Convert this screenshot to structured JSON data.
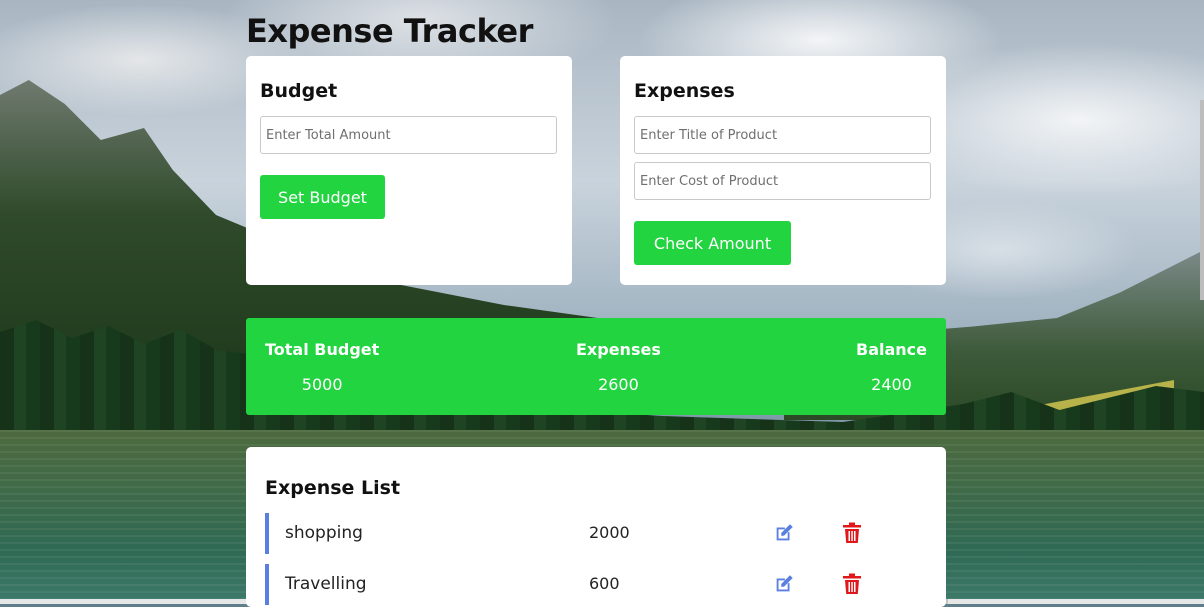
{
  "app": {
    "title": "Expense Tracker"
  },
  "budget": {
    "heading": "Budget",
    "amount_placeholder": "Enter Total Amount",
    "amount_value": "",
    "button_label": "Set Budget"
  },
  "expenses_form": {
    "heading": "Expenses",
    "title_placeholder": "Enter Title of Product",
    "title_value": "",
    "cost_placeholder": "Enter Cost of Product",
    "cost_value": "",
    "button_label": "Check Amount"
  },
  "summary": {
    "total_budget_label": "Total Budget",
    "total_budget_value": "5000",
    "expenses_label": "Expenses",
    "expenses_value": "2600",
    "balance_label": "Balance",
    "balance_value": "2400"
  },
  "expense_list": {
    "heading": "Expense List",
    "items": [
      {
        "name": "shopping",
        "amount": "2000",
        "edit_icon": "edit-icon",
        "delete_icon": "trash-icon"
      },
      {
        "name": "Travelling",
        "amount": "600",
        "edit_icon": "edit-icon",
        "delete_icon": "trash-icon"
      }
    ]
  },
  "colors": {
    "accent_green": "#22d43f",
    "list_border_blue": "#5b7fe0",
    "edit_icon_blue": "#5b7fe0",
    "delete_icon_red": "#e0181b"
  }
}
